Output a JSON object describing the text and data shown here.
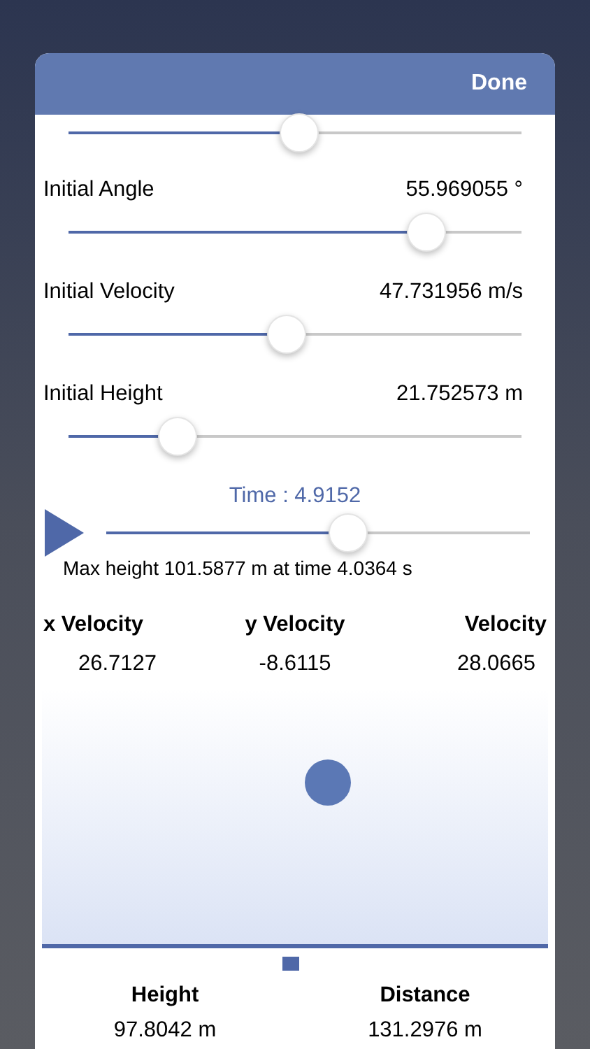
{
  "header": {
    "done_label": "Done"
  },
  "top_slider": {
    "level": 0.51
  },
  "parameters": [
    {
      "label": "Initial Angle",
      "value": "55.969055 °",
      "level": 0.79
    },
    {
      "label": "Initial Velocity",
      "value": "47.731956 m/s",
      "level": 0.48
    },
    {
      "label": "Initial Height",
      "value": "21.752573 m",
      "level": 0.24
    }
  ],
  "time": {
    "label": "Time : 4.9152",
    "level": 0.57
  },
  "max_height_text": "Max height 101.5877 m at time 4.0364 s",
  "velocities": [
    {
      "label": "x Velocity",
      "value": "26.7127"
    },
    {
      "label": "y Velocity",
      "value": "-8.6115"
    },
    {
      "label": "Velocity",
      "value": "28.0665"
    }
  ],
  "readouts": [
    {
      "label": "Height",
      "value": "97.8042 m"
    },
    {
      "label": "Distance",
      "value": "131.2976 m"
    }
  ]
}
